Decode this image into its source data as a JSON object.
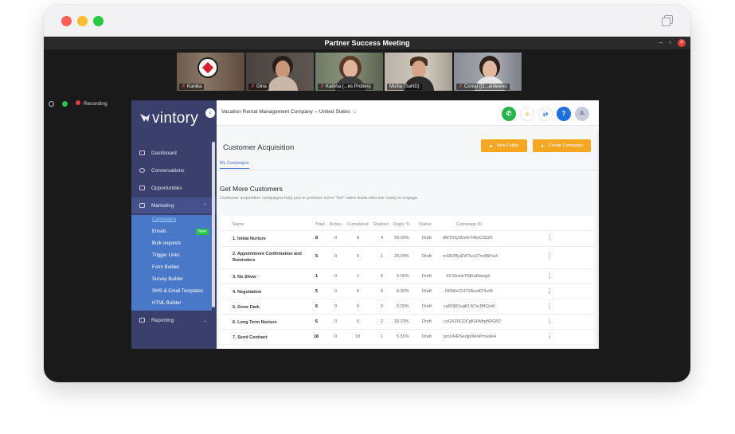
{
  "zoom": {
    "title": "Partner Success Meeting",
    "recording": "Recording",
    "participants": [
      {
        "name": "Kanika"
      },
      {
        "name": "Gina"
      },
      {
        "name": "Katrina (...es Probes)"
      },
      {
        "name": "Micha (SaND)"
      },
      {
        "name": "Consu (D...ardware)"
      }
    ]
  },
  "app": {
    "brand": "vintory",
    "company": "Vacation Rental Management Company -- United States",
    "avatar": "JL",
    "nav": [
      {
        "label": "Dashboard"
      },
      {
        "label": "Conversations"
      },
      {
        "label": "Opportunities"
      },
      {
        "label": "Marketing"
      },
      {
        "label": "Reporting"
      }
    ],
    "submenu": [
      {
        "label": "Campaigns"
      },
      {
        "label": "Emails",
        "badge": "New"
      },
      {
        "label": "Bulk requests"
      },
      {
        "label": "Trigger Links"
      },
      {
        "label": "Form Builder"
      },
      {
        "label": "Survey Builder"
      },
      {
        "label": "SMS & Email Templates"
      },
      {
        "label": "HTML Builder"
      }
    ],
    "page_title": "Customer Acquisition",
    "new_folder": "New Folder",
    "create_campaign": "Create Campaign",
    "tab": "My Campaigns",
    "section_title": "Get More Customers",
    "section_desc": "Customer acquisition campaigns help you to produce more \"hot\" sales leads who are ready to engage.",
    "columns": [
      "Name",
      "Total",
      "Active",
      "Completed",
      "Replied",
      "Reply %",
      "Status",
      "Campaign ID"
    ],
    "rows": [
      {
        "name": "1. Initial Nurture",
        "total": "8",
        "active": "0",
        "completed": "8",
        "replied": "4",
        "reply_pct": "50.00%",
        "status": "Draft",
        "id": "dMTcNy0DeKY4koC65Z6"
      },
      {
        "name": "2. Appointment Confirmation and Reminders",
        "total": "5",
        "active": "0",
        "completed": "5",
        "replied": "1",
        "reply_pct": "20.00%",
        "status": "Draft",
        "id": "mSBZf6yEWTuc3Tm4BPw3"
      },
      {
        "name": "3. No Show",
        "total": "1",
        "active": "0",
        "completed": "1",
        "replied": "0",
        "reply_pct": "0.00%",
        "status": "Draft",
        "id": "XCS5xxkTRjKaRawg3"
      },
      {
        "name": "4. Negotiation",
        "total": "5",
        "active": "0",
        "completed": "5",
        "replied": "0",
        "reply_pct": "0.00%",
        "status": "Draft",
        "id": "RRb5eCH7SArxdDI1vrB"
      },
      {
        "name": "5. Gone Dark",
        "total": "6",
        "active": "0",
        "completed": "6",
        "replied": "0",
        "reply_pct": "0.00%",
        "status": "Draft",
        "id": "cgR0jfClugKLN7wJBfQzld"
      },
      {
        "name": "6. Long Term Nurture",
        "total": "6",
        "active": "0",
        "completed": "6",
        "replied": "2",
        "reply_pct": "33.33%",
        "status": "Draft",
        "id": "cyGXZ6CDCgKHWbghRGB2"
      },
      {
        "name": "7. Send Contract",
        "total": "18",
        "active": "0",
        "completed": "18",
        "replied": "1",
        "reply_pct": "5.55%",
        "status": "Draft",
        "id": "proUHRSedjp0MnPmwde4"
      }
    ]
  },
  "colors": {
    "sidebar": "#3a3f6b",
    "submenu": "#4a78c8",
    "accent_orange": "#f5a623",
    "call_green": "#27b34a",
    "help_blue": "#1e6fe0"
  }
}
